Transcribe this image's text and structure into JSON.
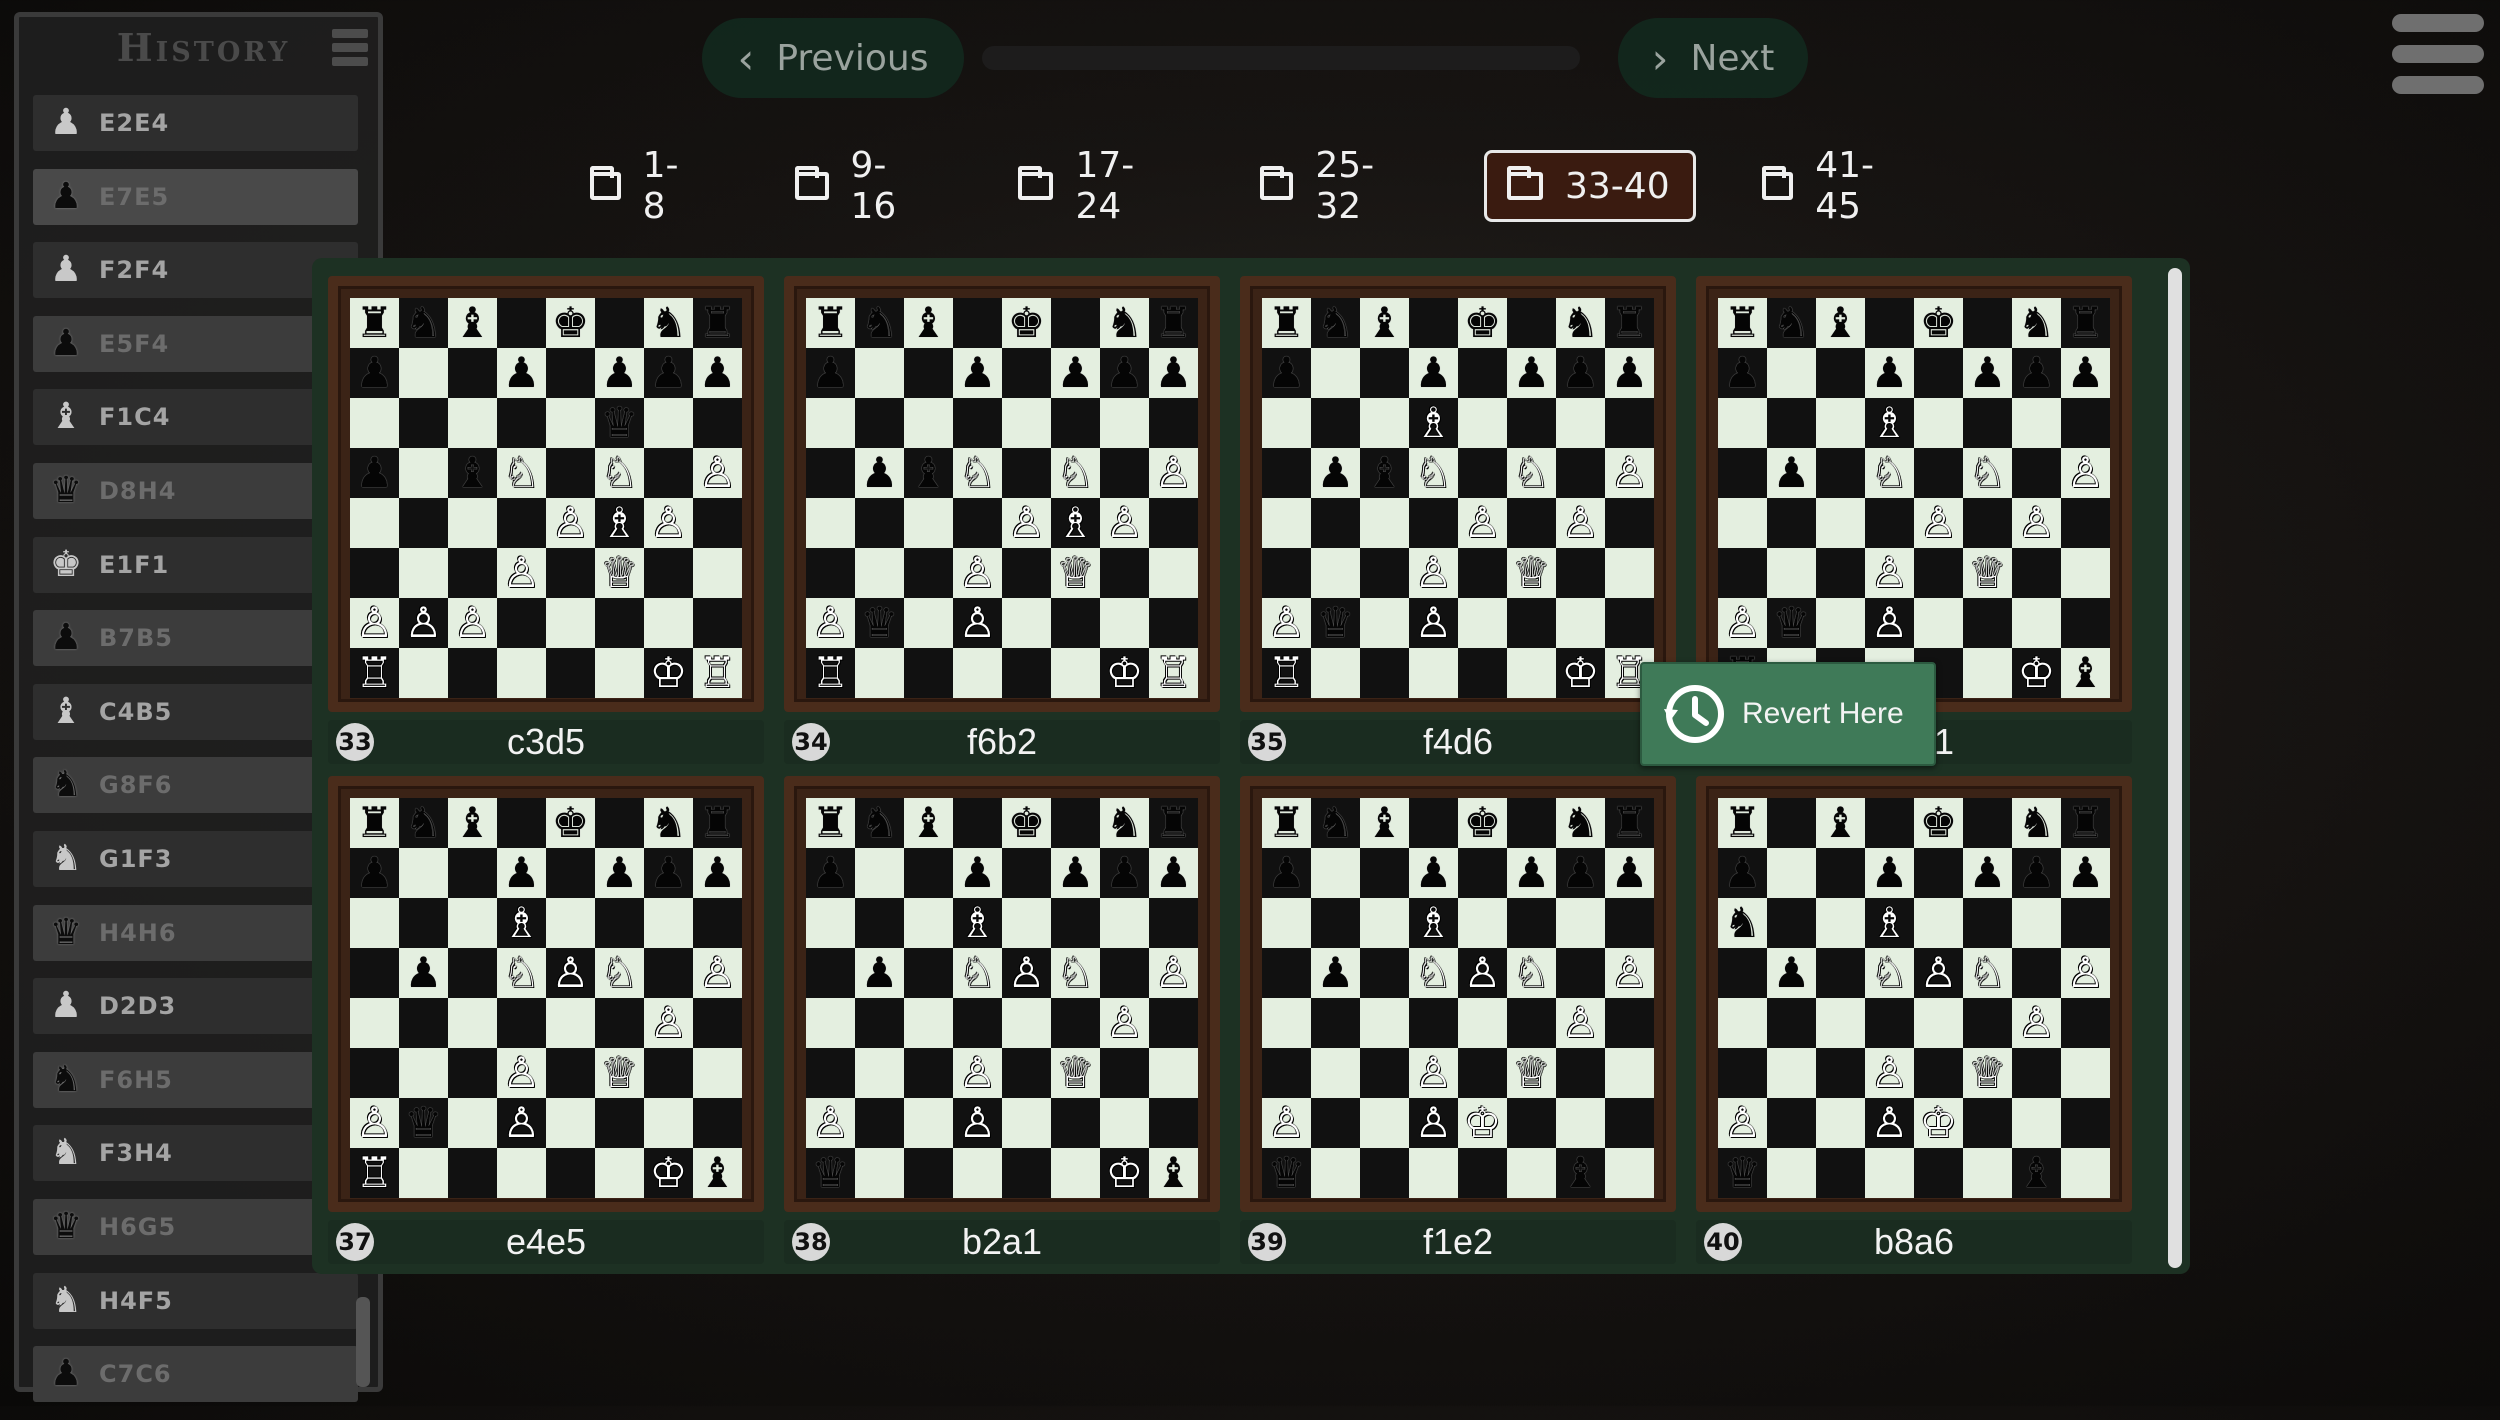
{
  "history": {
    "title": "History",
    "moves": [
      {
        "piece": "♟",
        "color": "w",
        "move": "E2E4"
      },
      {
        "piece": "♟",
        "color": "b",
        "move": "E7E5"
      },
      {
        "piece": "♟",
        "color": "w",
        "move": "F2F4"
      },
      {
        "piece": "♟",
        "color": "b",
        "move": "E5F4"
      },
      {
        "piece": "♝",
        "color": "w",
        "move": "F1C4"
      },
      {
        "piece": "♛",
        "color": "b",
        "move": "D8H4"
      },
      {
        "piece": "♚",
        "color": "w",
        "move": "E1F1"
      },
      {
        "piece": "♟",
        "color": "b",
        "move": "B7B5"
      },
      {
        "piece": "♝",
        "color": "w",
        "move": "C4B5"
      },
      {
        "piece": "♞",
        "color": "b",
        "move": "G8F6"
      },
      {
        "piece": "♞",
        "color": "w",
        "move": "G1F3"
      },
      {
        "piece": "♛",
        "color": "b",
        "move": "H4H6"
      },
      {
        "piece": "♟",
        "color": "w",
        "move": "D2D3"
      },
      {
        "piece": "♞",
        "color": "b",
        "move": "F6H5"
      },
      {
        "piece": "♞",
        "color": "w",
        "move": "F3H4"
      },
      {
        "piece": "♛",
        "color": "b",
        "move": "H6G5"
      },
      {
        "piece": "♞",
        "color": "w",
        "move": "H4F5"
      },
      {
        "piece": "♟",
        "color": "b",
        "move": "C7C6"
      }
    ]
  },
  "nav": {
    "previous": "Previous",
    "next": "Next"
  },
  "tabs": [
    "1-8",
    "9-16",
    "17-24",
    "25-32",
    "33-40",
    "41-45"
  ],
  "active_tab": 4,
  "boards": [
    {
      "num": "33",
      "move": "c3d5",
      "rows": [
        "rnb.k.nr",
        "p..p.ppp",
        ".....q..",
        "p.bN.N.P",
        "....PBP.",
        "...P.Q..",
        "PPP.....",
        "R.....KR"
      ]
    },
    {
      "num": "34",
      "move": "f6b2",
      "rows": [
        "rnb.k.nr",
        "p..p.ppp",
        "........",
        ".pbN.N.P",
        "....PBP.",
        "...P.Q..",
        "Pq.P....",
        "R.....KR"
      ]
    },
    {
      "num": "35",
      "move": "f4d6",
      "rows": [
        "rnb.k.nr",
        "p..p.ppp",
        "...B....",
        ".pbN.N.P",
        "....P.P.",
        "...P.Q..",
        "Pq.P....",
        "R.....KR"
      ]
    },
    {
      "num": "36",
      "move": "b2a1",
      "rows": [
        "rnb.k.nr",
        "p..p.ppp",
        "...B....",
        ".p.N.N.P",
        "....P.P.",
        "...P.Q..",
        "Pq.P....",
        "r.....Kb"
      ]
    },
    {
      "num": "37",
      "move": "e4e5",
      "rows": [
        "rnb.k.nr",
        "p..p.ppp",
        "...B....",
        ".p.NPN.P",
        "......P.",
        "...P.Q..",
        "Pq.P....",
        "R.....Kb"
      ]
    },
    {
      "num": "38",
      "move": "b2a1",
      "rows": [
        "rnb.k.nr",
        "p..p.ppp",
        "...B....",
        ".p.NPN.P",
        "......P.",
        "...P.Q..",
        "P..P....",
        "q.....Kb"
      ]
    },
    {
      "num": "39",
      "move": "f1e2",
      "rows": [
        "rnb.k.nr",
        "p..p.ppp",
        "...B....",
        ".p.NPN.P",
        "......P.",
        "...P.Q..",
        "P..PK...",
        "q.....b."
      ]
    },
    {
      "num": "40",
      "move": "b8a6",
      "rows": [
        "r.b.k.nr",
        "p..p.ppp",
        "n..B....",
        ".p.NPN.P",
        "......P.",
        "...P.Q..",
        "P..PK...",
        "q.....b."
      ]
    }
  ],
  "revert": {
    "label": "Revert Here",
    "icon": "history-clock-icon"
  }
}
